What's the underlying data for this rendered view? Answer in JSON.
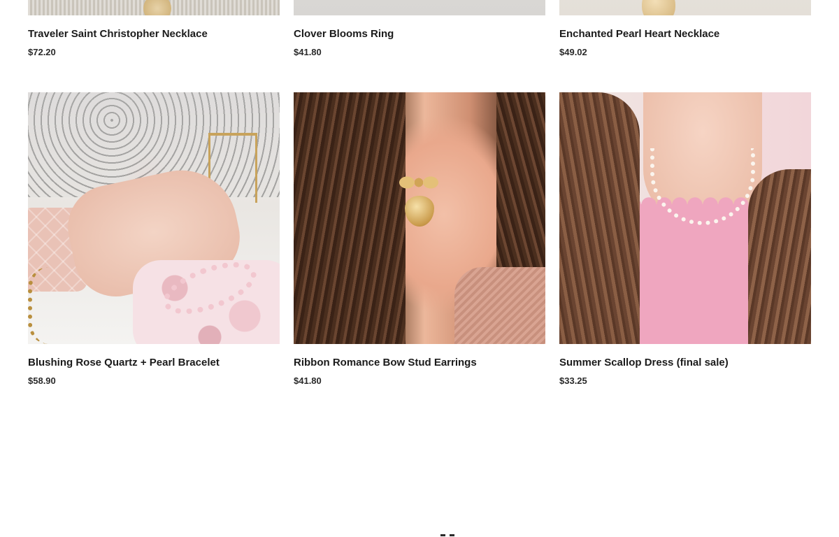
{
  "products_top_row": [
    {
      "title": "Traveler Saint Christopher Necklace",
      "price": "$72.20",
      "image": "traveler-necklace-photo"
    },
    {
      "title": "Clover Blooms Ring",
      "price": "$41.80",
      "image": "clover-ring-photo"
    },
    {
      "title": "Enchanted Pearl Heart Necklace",
      "price": "$49.02",
      "image": "pearl-heart-necklace-photo"
    }
  ],
  "products_bottom_row": [
    {
      "title": "Blushing Rose Quartz + Pearl Bracelet",
      "price": "$58.90",
      "image": "rose-quartz-bracelet-photo"
    },
    {
      "title": "Ribbon Romance Bow Stud Earrings",
      "price": "$41.80",
      "image": "bow-stud-earrings-photo"
    },
    {
      "title": "Summer Scallop Dress (final sale)",
      "price": "$33.25",
      "image": "scallop-dress-photo"
    }
  ],
  "colors": {
    "text": "#1b1b1b",
    "background": "#ffffff",
    "dress_pink": "#efa6bf",
    "gold": "#c99a4a"
  }
}
